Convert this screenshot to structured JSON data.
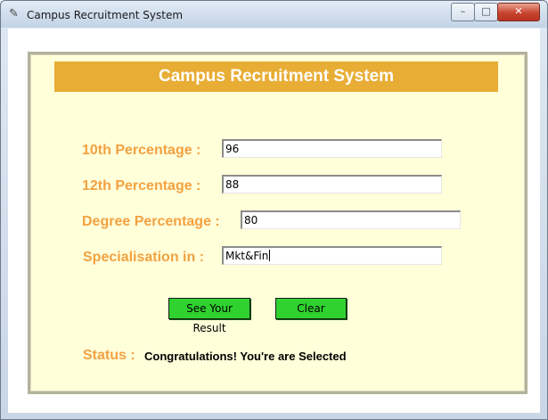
{
  "window": {
    "title": "Campus Recruitment System",
    "app_icon": "feather-icon",
    "controls": {
      "minimize": "–",
      "maximize": "□",
      "close": "✕"
    }
  },
  "header": {
    "title": "Campus Recruitment System"
  },
  "form": {
    "tenth": {
      "label": "10th Percentage :",
      "value": "96"
    },
    "twelfth": {
      "label": "12th Percentage :",
      "value": "88"
    },
    "degree": {
      "label": "Degree Percentage :",
      "value": "80"
    },
    "specialisation": {
      "label": "Specialisation in :",
      "value": "Mkt&Fin"
    }
  },
  "buttons": {
    "result": "See Your Result",
    "clear": "Clear"
  },
  "status": {
    "label": "Status :",
    "message": "Congratulations! You're are Selected"
  },
  "colors": {
    "panel_bg": "#ffffda",
    "header_bg": "#e8ad35",
    "label_text": "#f3a141",
    "button_bg": "#2fd22f"
  }
}
